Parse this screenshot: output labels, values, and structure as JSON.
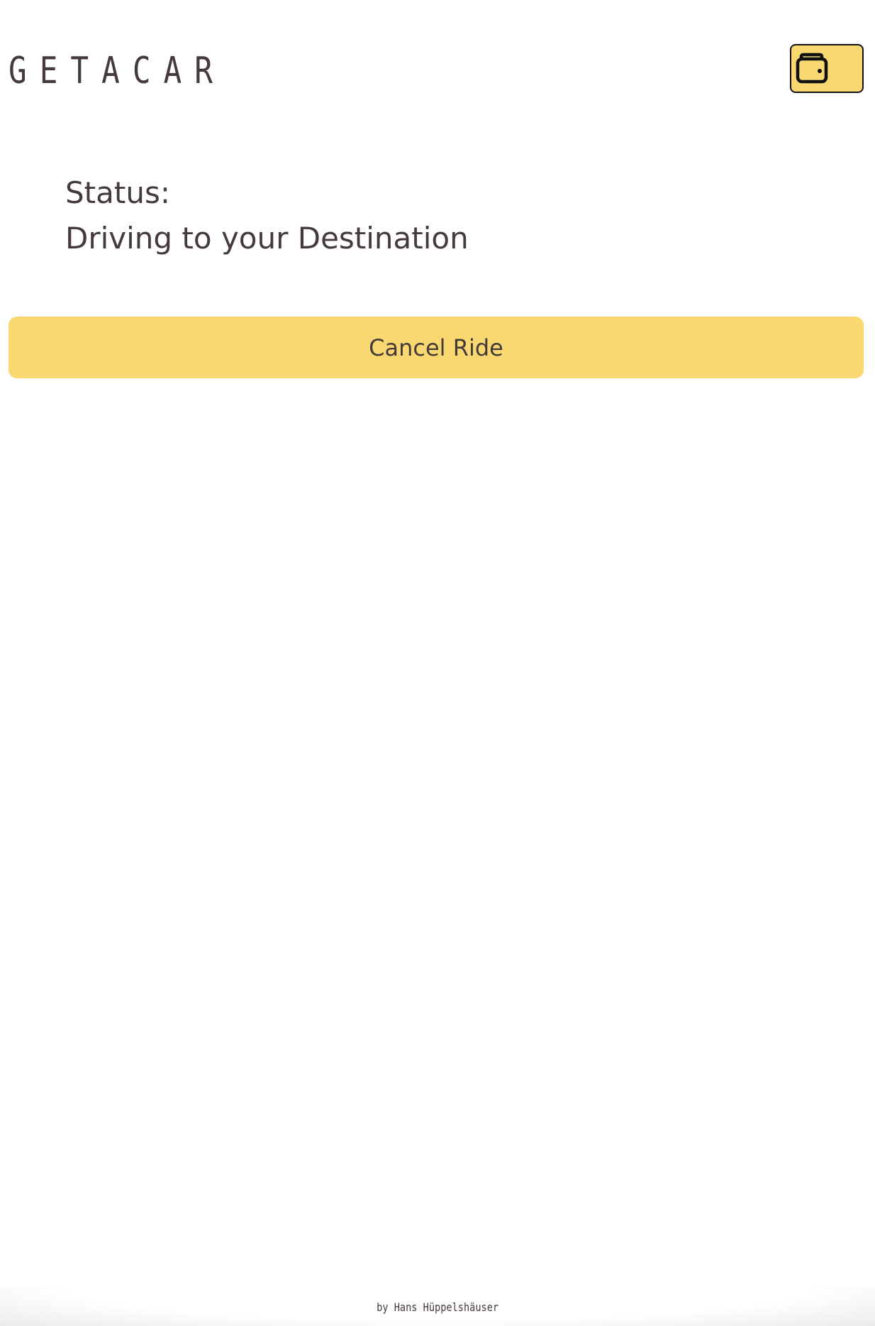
{
  "header": {
    "logo": "GETACAR"
  },
  "wallet": {
    "icon": "wallet-icon",
    "color": "#f9d871"
  },
  "status": {
    "label": "Status:",
    "value": "Driving to your Destination"
  },
  "actions": {
    "cancel_label": "Cancel Ride"
  },
  "footer": {
    "credit": "by Hans Hüppelshäuser"
  },
  "colors": {
    "accent": "#f9d871",
    "text": "#453a3a"
  }
}
